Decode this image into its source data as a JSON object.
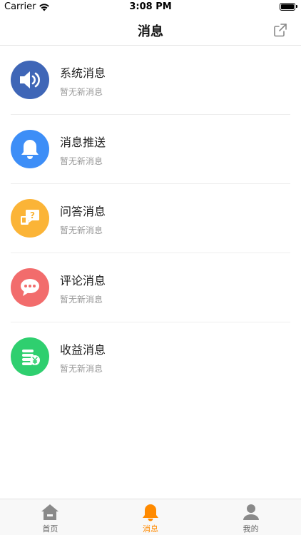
{
  "status_bar": {
    "carrier": "Carrier",
    "time": "3:08 PM"
  },
  "nav": {
    "title": "消息",
    "share_icon": "share-icon"
  },
  "messages": [
    {
      "title": "系统消息",
      "subtitle": "暂无新消息",
      "icon": "speaker-icon",
      "color": "#3f66b7"
    },
    {
      "title": "消息推送",
      "subtitle": "暂无新消息",
      "icon": "bell-icon",
      "color": "#3d8ef7"
    },
    {
      "title": "问答消息",
      "subtitle": "暂无新消息",
      "icon": "question-chat-icon",
      "color": "#fbb437"
    },
    {
      "title": "评论消息",
      "subtitle": "暂无新消息",
      "icon": "comment-icon",
      "color": "#f26c6c"
    },
    {
      "title": "收益消息",
      "subtitle": "暂无新消息",
      "icon": "coins-yuan-icon",
      "color": "#2fcf6f"
    }
  ],
  "tabs": [
    {
      "label": "首页",
      "icon": "home-icon",
      "active": false
    },
    {
      "label": "消息",
      "icon": "bell-icon",
      "active": true
    },
    {
      "label": "我的",
      "icon": "user-icon",
      "active": false
    }
  ],
  "colors": {
    "accent": "#ff8a00",
    "subtitle": "#999999"
  }
}
